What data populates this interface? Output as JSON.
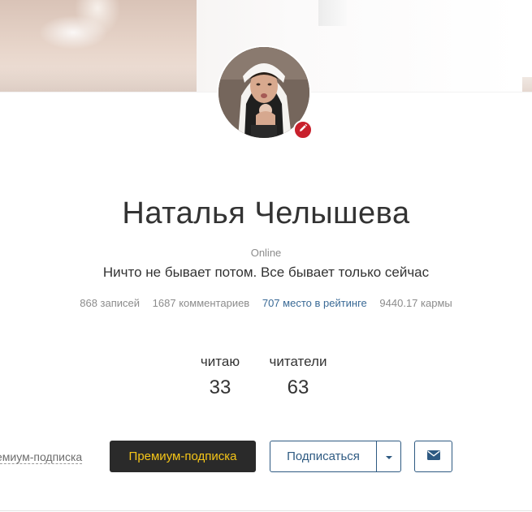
{
  "profile": {
    "name": "Наталья Челышева",
    "status": "Online",
    "bio": "Ничто не бывает потом. Все бывает только сейчас"
  },
  "stats": {
    "posts": "868 записей",
    "comments": "1687 комментариев",
    "rating": "707 место в рейтинге",
    "karma": "9440.17 кармы"
  },
  "follow": {
    "reading_label": "читаю",
    "reading_count": "33",
    "readers_label": "читатели",
    "readers_count": "63"
  },
  "actions": {
    "premium_link": "емиум-подписка",
    "premium_button": "Премиум-подписка",
    "subscribe_button": "Подписаться"
  },
  "colors": {
    "accent": "#2e5a82",
    "premium_text": "#f5c518",
    "premium_bg": "#2a2a2a",
    "badge": "#c8202c"
  },
  "icons": {
    "edit": "pencil-icon",
    "dropdown": "caret-down-icon",
    "message": "envelope-icon"
  }
}
